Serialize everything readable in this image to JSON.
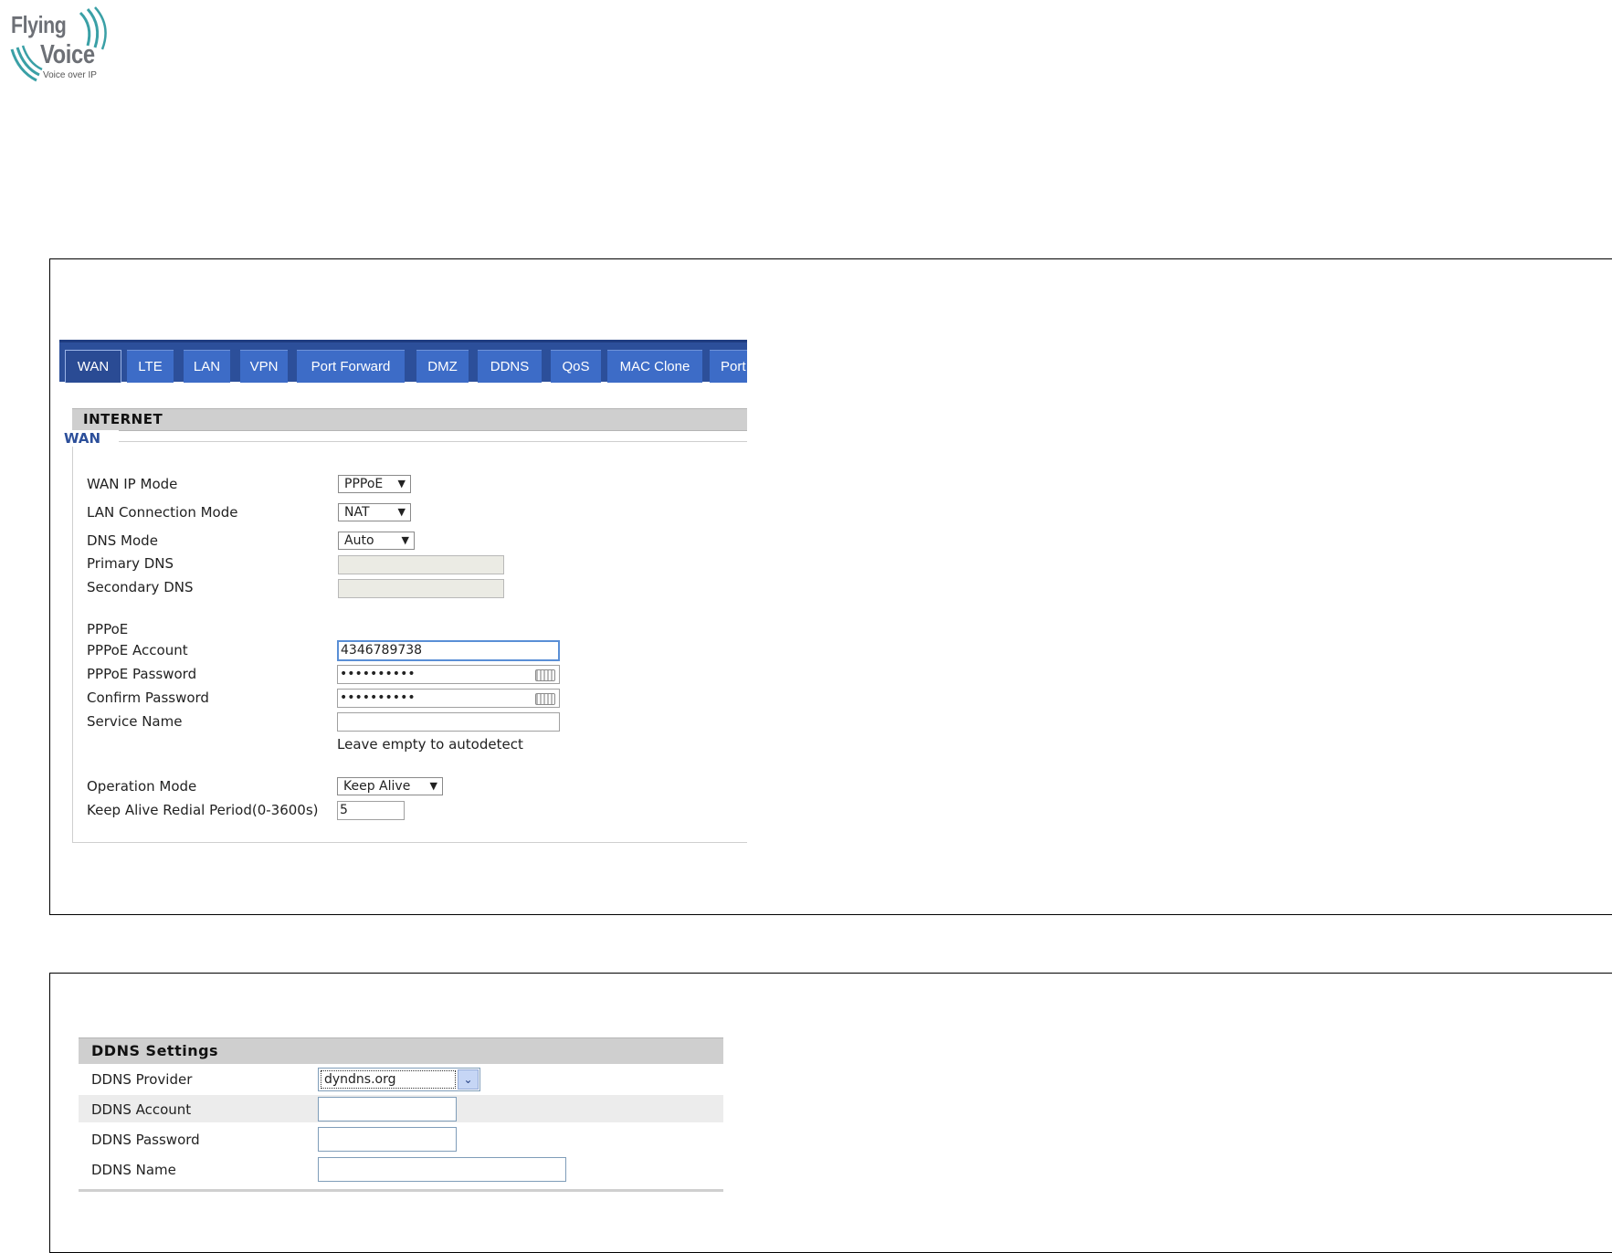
{
  "logo": {
    "line1": "Flying",
    "line2": "Voice",
    "tagline": "Voice over IP",
    "colors": {
      "text": "#6d7076",
      "wave": "#3aa0a6"
    }
  },
  "wan_page": {
    "tabs": [
      {
        "label": "WAN",
        "active": true
      },
      {
        "label": "LTE",
        "active": false
      },
      {
        "label": "LAN",
        "active": false
      },
      {
        "label": "VPN",
        "active": false
      },
      {
        "label": "Port Forward",
        "active": false
      },
      {
        "label": "DMZ",
        "active": false
      },
      {
        "label": "DDNS",
        "active": false
      },
      {
        "label": "QoS",
        "active": false
      },
      {
        "label": "MAC Clone",
        "active": false
      },
      {
        "label": "Port",
        "active": false
      }
    ],
    "section_title": "INTERNET",
    "legend": "WAN",
    "fields": {
      "wan_ip_mode": {
        "label": "WAN IP Mode",
        "value": "PPPoE"
      },
      "lan_connection_mode": {
        "label": "LAN Connection Mode",
        "value": "NAT"
      },
      "dns_mode": {
        "label": "DNS Mode",
        "value": "Auto"
      },
      "primary_dns": {
        "label": "Primary DNS",
        "value": ""
      },
      "secondary_dns": {
        "label": "Secondary DNS",
        "value": ""
      },
      "pppoe_heading": "PPPoE",
      "pppoe_account": {
        "label": "PPPoE Account",
        "value": "4346789738"
      },
      "pppoe_password": {
        "label": "PPPoE Password",
        "value": "••••••••••"
      },
      "confirm_password": {
        "label": "Confirm Password",
        "value": "••••••••••"
      },
      "service_name": {
        "label": "Service Name",
        "value": "",
        "hint": "Leave empty to autodetect"
      },
      "operation_mode": {
        "label": "Operation Mode",
        "value": "Keep Alive"
      },
      "keep_alive_period": {
        "label": "Keep Alive Redial Period(0-3600s)",
        "value": "5"
      }
    },
    "dropdown_arrow": "▼",
    "colors": {
      "tab_bar": "#2c4f9a",
      "tab": "#3d6cc7",
      "legend": "#2c4f9a"
    }
  },
  "ddns_page": {
    "section_title": "DDNS Settings",
    "rows": [
      {
        "label": "DDNS Provider",
        "value": "dyndns.org"
      },
      {
        "label": "DDNS Account",
        "value": ""
      },
      {
        "label": "DDNS Password",
        "value": ""
      },
      {
        "label": "DDNS Name",
        "value": ""
      }
    ],
    "dropdown_arrow": "⌄"
  }
}
